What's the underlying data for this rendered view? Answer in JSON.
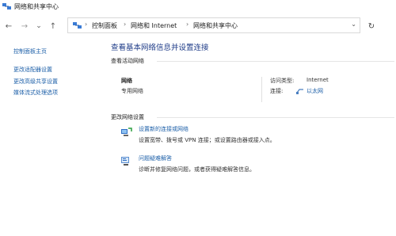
{
  "window": {
    "title": "网络和共享中心",
    "icon": "network-center-icon"
  },
  "nav": {
    "back": "←",
    "forward": "→",
    "recent": "⌄",
    "up": "↑",
    "refresh": "↻"
  },
  "address": {
    "sep": "›",
    "crumbs": [
      "控制面板",
      "网络和 Internet",
      "网络和共享中心"
    ],
    "dropdown": "⌄"
  },
  "sidebar": {
    "home": "控制面板主页",
    "links": [
      "更改适配器设置",
      "更改高级共享设置",
      "媒体流式处理选项"
    ]
  },
  "main": {
    "heading": "查看基本网络信息并设置连接",
    "active_label": "查看活动网络",
    "network": {
      "name": "网络",
      "category": "专用网络",
      "access_type_label": "访问类型:",
      "access_type_value": "Internet",
      "connection_label": "连接:",
      "connection_value": "以太网"
    },
    "change_label": "更改网络设置",
    "tasks": [
      {
        "icon": "new-connection-icon",
        "link": "设置新的连接或网络",
        "desc": "设置宽带、拨号或 VPN 连接；或设置路由器或接入点。"
      },
      {
        "icon": "troubleshoot-icon",
        "link": "问题疑难解答",
        "desc": "诊断并修复网络问题，或者获得疑难解答信息。"
      }
    ]
  },
  "colors": {
    "link": "#1c5fa8",
    "heading": "#1f3c88"
  }
}
